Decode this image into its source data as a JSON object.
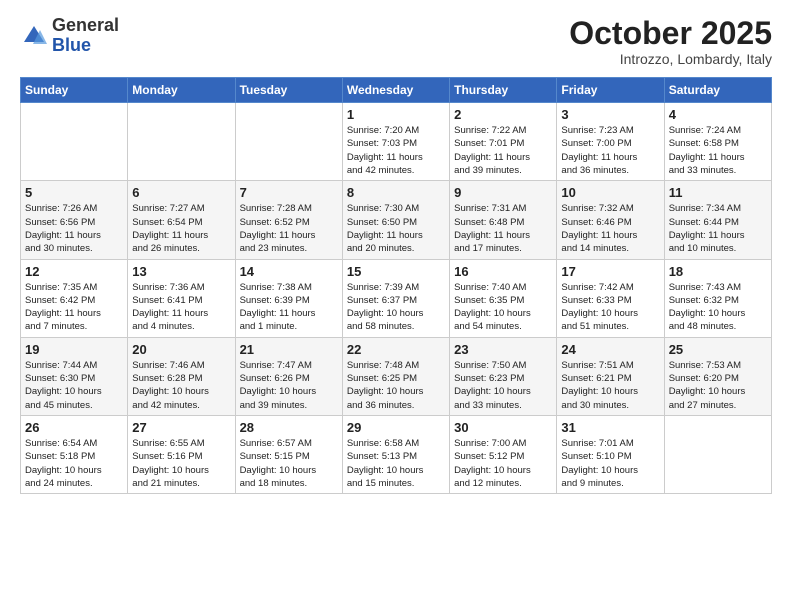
{
  "header": {
    "logo_general": "General",
    "logo_blue": "Blue",
    "title": "October 2025",
    "subtitle": "Introzzo, Lombardy, Italy"
  },
  "days_of_week": [
    "Sunday",
    "Monday",
    "Tuesday",
    "Wednesday",
    "Thursday",
    "Friday",
    "Saturday"
  ],
  "weeks": [
    [
      {
        "day": "",
        "info": ""
      },
      {
        "day": "",
        "info": ""
      },
      {
        "day": "",
        "info": ""
      },
      {
        "day": "1",
        "info": "Sunrise: 7:20 AM\nSunset: 7:03 PM\nDaylight: 11 hours\nand 42 minutes."
      },
      {
        "day": "2",
        "info": "Sunrise: 7:22 AM\nSunset: 7:01 PM\nDaylight: 11 hours\nand 39 minutes."
      },
      {
        "day": "3",
        "info": "Sunrise: 7:23 AM\nSunset: 7:00 PM\nDaylight: 11 hours\nand 36 minutes."
      },
      {
        "day": "4",
        "info": "Sunrise: 7:24 AM\nSunset: 6:58 PM\nDaylight: 11 hours\nand 33 minutes."
      }
    ],
    [
      {
        "day": "5",
        "info": "Sunrise: 7:26 AM\nSunset: 6:56 PM\nDaylight: 11 hours\nand 30 minutes."
      },
      {
        "day": "6",
        "info": "Sunrise: 7:27 AM\nSunset: 6:54 PM\nDaylight: 11 hours\nand 26 minutes."
      },
      {
        "day": "7",
        "info": "Sunrise: 7:28 AM\nSunset: 6:52 PM\nDaylight: 11 hours\nand 23 minutes."
      },
      {
        "day": "8",
        "info": "Sunrise: 7:30 AM\nSunset: 6:50 PM\nDaylight: 11 hours\nand 20 minutes."
      },
      {
        "day": "9",
        "info": "Sunrise: 7:31 AM\nSunset: 6:48 PM\nDaylight: 11 hours\nand 17 minutes."
      },
      {
        "day": "10",
        "info": "Sunrise: 7:32 AM\nSunset: 6:46 PM\nDaylight: 11 hours\nand 14 minutes."
      },
      {
        "day": "11",
        "info": "Sunrise: 7:34 AM\nSunset: 6:44 PM\nDaylight: 11 hours\nand 10 minutes."
      }
    ],
    [
      {
        "day": "12",
        "info": "Sunrise: 7:35 AM\nSunset: 6:42 PM\nDaylight: 11 hours\nand 7 minutes."
      },
      {
        "day": "13",
        "info": "Sunrise: 7:36 AM\nSunset: 6:41 PM\nDaylight: 11 hours\nand 4 minutes."
      },
      {
        "day": "14",
        "info": "Sunrise: 7:38 AM\nSunset: 6:39 PM\nDaylight: 11 hours\nand 1 minute."
      },
      {
        "day": "15",
        "info": "Sunrise: 7:39 AM\nSunset: 6:37 PM\nDaylight: 10 hours\nand 58 minutes."
      },
      {
        "day": "16",
        "info": "Sunrise: 7:40 AM\nSunset: 6:35 PM\nDaylight: 10 hours\nand 54 minutes."
      },
      {
        "day": "17",
        "info": "Sunrise: 7:42 AM\nSunset: 6:33 PM\nDaylight: 10 hours\nand 51 minutes."
      },
      {
        "day": "18",
        "info": "Sunrise: 7:43 AM\nSunset: 6:32 PM\nDaylight: 10 hours\nand 48 minutes."
      }
    ],
    [
      {
        "day": "19",
        "info": "Sunrise: 7:44 AM\nSunset: 6:30 PM\nDaylight: 10 hours\nand 45 minutes."
      },
      {
        "day": "20",
        "info": "Sunrise: 7:46 AM\nSunset: 6:28 PM\nDaylight: 10 hours\nand 42 minutes."
      },
      {
        "day": "21",
        "info": "Sunrise: 7:47 AM\nSunset: 6:26 PM\nDaylight: 10 hours\nand 39 minutes."
      },
      {
        "day": "22",
        "info": "Sunrise: 7:48 AM\nSunset: 6:25 PM\nDaylight: 10 hours\nand 36 minutes."
      },
      {
        "day": "23",
        "info": "Sunrise: 7:50 AM\nSunset: 6:23 PM\nDaylight: 10 hours\nand 33 minutes."
      },
      {
        "day": "24",
        "info": "Sunrise: 7:51 AM\nSunset: 6:21 PM\nDaylight: 10 hours\nand 30 minutes."
      },
      {
        "day": "25",
        "info": "Sunrise: 7:53 AM\nSunset: 6:20 PM\nDaylight: 10 hours\nand 27 minutes."
      }
    ],
    [
      {
        "day": "26",
        "info": "Sunrise: 6:54 AM\nSunset: 5:18 PM\nDaylight: 10 hours\nand 24 minutes."
      },
      {
        "day": "27",
        "info": "Sunrise: 6:55 AM\nSunset: 5:16 PM\nDaylight: 10 hours\nand 21 minutes."
      },
      {
        "day": "28",
        "info": "Sunrise: 6:57 AM\nSunset: 5:15 PM\nDaylight: 10 hours\nand 18 minutes."
      },
      {
        "day": "29",
        "info": "Sunrise: 6:58 AM\nSunset: 5:13 PM\nDaylight: 10 hours\nand 15 minutes."
      },
      {
        "day": "30",
        "info": "Sunrise: 7:00 AM\nSunset: 5:12 PM\nDaylight: 10 hours\nand 12 minutes."
      },
      {
        "day": "31",
        "info": "Sunrise: 7:01 AM\nSunset: 5:10 PM\nDaylight: 10 hours\nand 9 minutes."
      },
      {
        "day": "",
        "info": ""
      }
    ]
  ]
}
